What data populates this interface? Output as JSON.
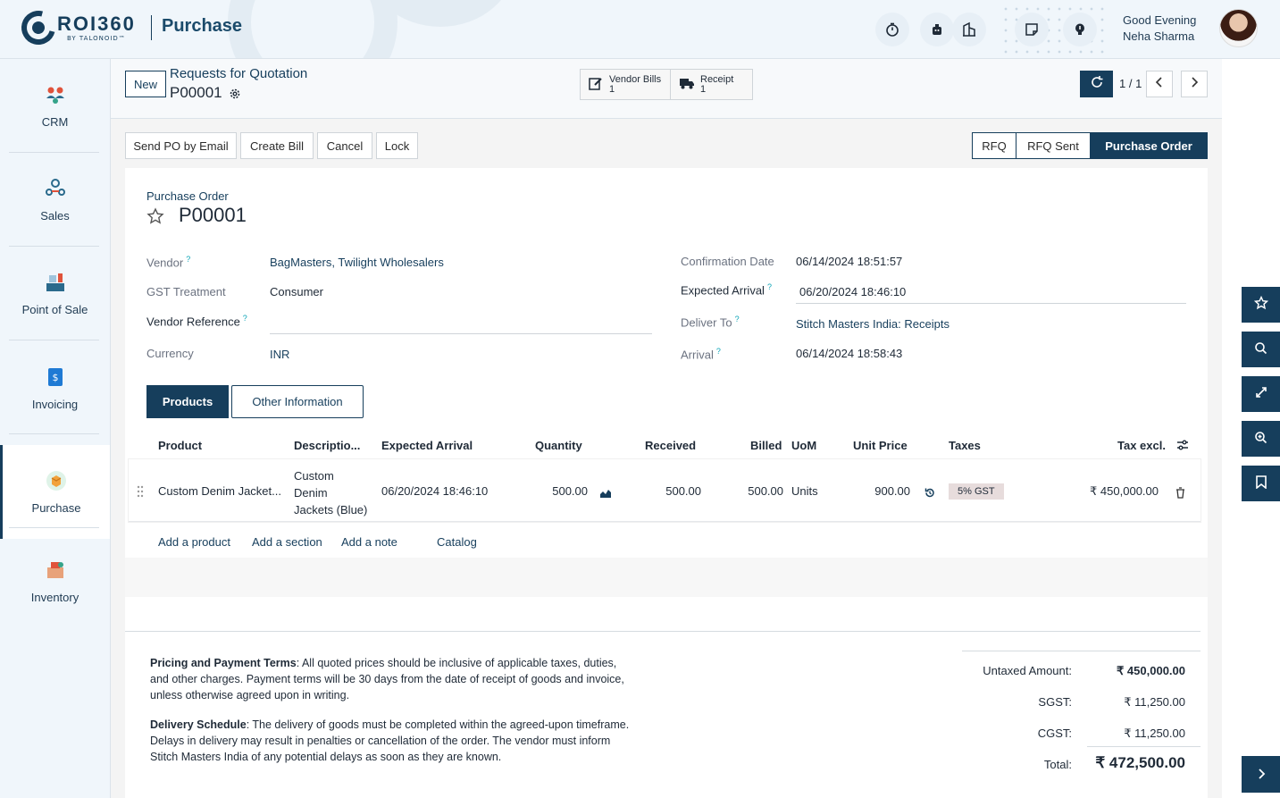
{
  "brand": {
    "name": "ROI360",
    "tagline": "BY TALONOID™"
  },
  "header": {
    "app_title": "Purchase",
    "greeting": "Good Evening",
    "user_name": "Neha Sharma",
    "icons": [
      "timer-icon",
      "chat-bot-icon",
      "company-icon",
      "notes-icon",
      "idea-icon"
    ]
  },
  "sidebar": {
    "items": [
      {
        "label": "CRM",
        "icon": "crm-icon"
      },
      {
        "label": "Sales",
        "icon": "sales-icon"
      },
      {
        "label": "Point of Sale",
        "icon": "point-of-sale-icon"
      },
      {
        "label": "Invoicing",
        "icon": "invoicing-icon"
      },
      {
        "label": "Purchase",
        "icon": "purchase-icon",
        "active": true
      },
      {
        "label": "Inventory",
        "icon": "inventory-icon"
      }
    ]
  },
  "control": {
    "new_label": "New",
    "breadcrumb": "Requests for Quotation",
    "record": "P00001",
    "smart_buttons": [
      {
        "label": "Vendor Bills",
        "count": "1"
      },
      {
        "label": "Receipt",
        "count": "1"
      }
    ],
    "pager": "1 / 1"
  },
  "actions": [
    "Send PO by Email",
    "Create Bill",
    "Cancel",
    "Lock"
  ],
  "status": {
    "steps": [
      "RFQ",
      "RFQ Sent",
      "Purchase Order"
    ],
    "current": "Purchase Order"
  },
  "form": {
    "type_label": "Purchase Order",
    "name": "P00001",
    "vendor_label": "Vendor",
    "vendor": "BagMasters, Twilight Wholesalers",
    "gst_label": "GST Treatment",
    "gst": "Consumer",
    "vendor_ref_label": "Vendor Reference",
    "vendor_ref": "",
    "currency_label": "Currency",
    "currency": "INR",
    "confirm_label": "Confirmation Date",
    "confirm": "06/14/2024 18:51:57",
    "expected_label": "Expected Arrival",
    "expected": "06/20/2024 18:46:10",
    "deliver_label": "Deliver To",
    "deliver": "Stitch Masters India: Receipts",
    "arrival_label": "Arrival",
    "arrival": "06/14/2024 18:58:43",
    "help_mark": "?"
  },
  "tabs": [
    "Products",
    "Other Information"
  ],
  "table": {
    "columns": [
      "Product",
      "Descriptio...",
      "Expected Arrival",
      "Quantity",
      "Received",
      "Billed",
      "UoM",
      "Unit Price",
      "Taxes",
      "Tax excl."
    ],
    "rows": [
      {
        "product": "Custom Denim Jacket...",
        "description": [
          "Custom",
          "Denim",
          "Jackets (Blue)"
        ],
        "expected": "06/20/2024 18:46:10",
        "quantity": "500.00",
        "received": "500.00",
        "billed": "500.00",
        "uom": "Units",
        "unit_price": "900.00",
        "tax": "5% GST",
        "subtotal": "₹ 450,000.00"
      }
    ],
    "add_links": [
      "Add a product",
      "Add a section",
      "Add a note",
      "Catalog"
    ]
  },
  "terms": [
    {
      "title": "Pricing and Payment Terms",
      "text": ": All quoted prices should be inclusive of applicable taxes, duties, and other charges. Payment terms will be 30 days from the date of receipt of goods and invoice, unless otherwise agreed upon in writing."
    },
    {
      "title": "Delivery Schedule",
      "text": ": The delivery of goods must be completed within the agreed-upon timeframe. Delays in delivery may result in penalties or cancellation of the order. The vendor must inform Stitch Masters India of any potential delays as soon as they are known."
    }
  ],
  "totals": {
    "untaxed_label": "Untaxed Amount:",
    "untaxed": "₹ 450,000.00",
    "sgst_label": "SGST:",
    "sgst": "₹ 11,250.00",
    "cgst_label": "CGST:",
    "cgst": "₹ 11,250.00",
    "total_label": "Total:",
    "total": "₹ 472,500.00"
  },
  "colors": {
    "primary": "#163e5c",
    "accent": "#0ea5b7",
    "background": "#f0f6fb"
  }
}
